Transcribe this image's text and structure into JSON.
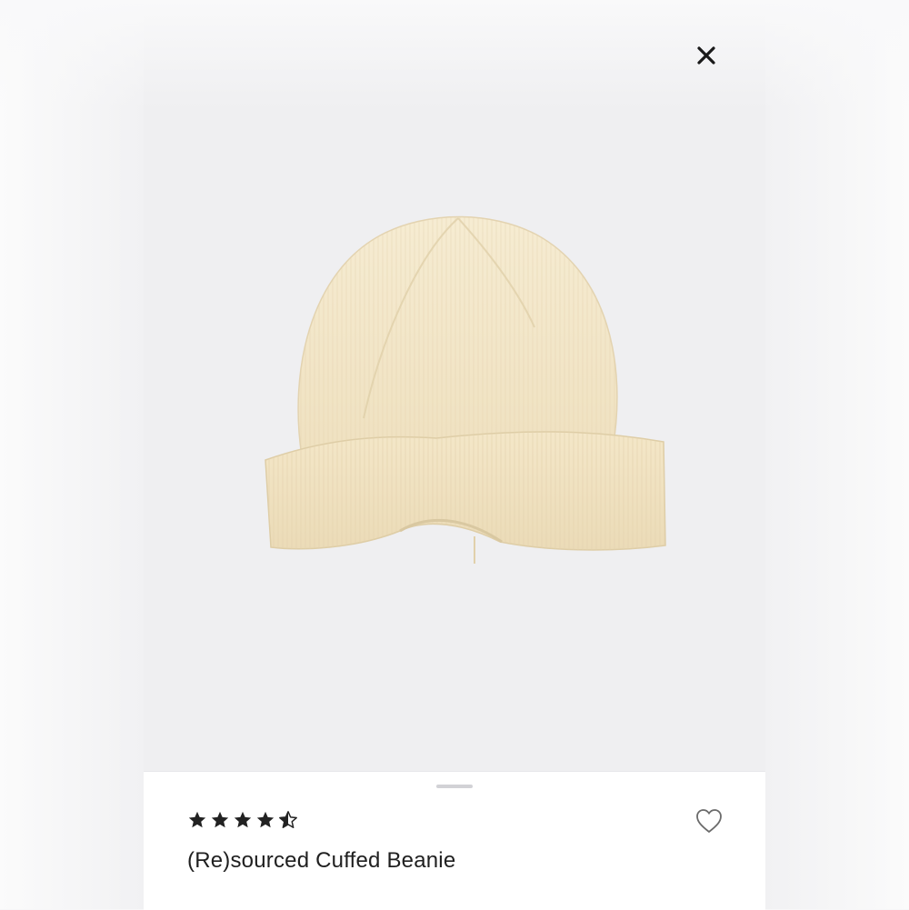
{
  "modal": {
    "close_icon": "close-icon",
    "close_color": "#1a1a1a"
  },
  "product": {
    "image_icon": "knit-beanie-image",
    "image_color": "#f3e6c8",
    "rating": 4.5,
    "rating_max": 5,
    "star_color": "#222222",
    "name": "(Re)sourced Cuffed Beanie",
    "wishlist_icon": "heart-outline-icon"
  }
}
